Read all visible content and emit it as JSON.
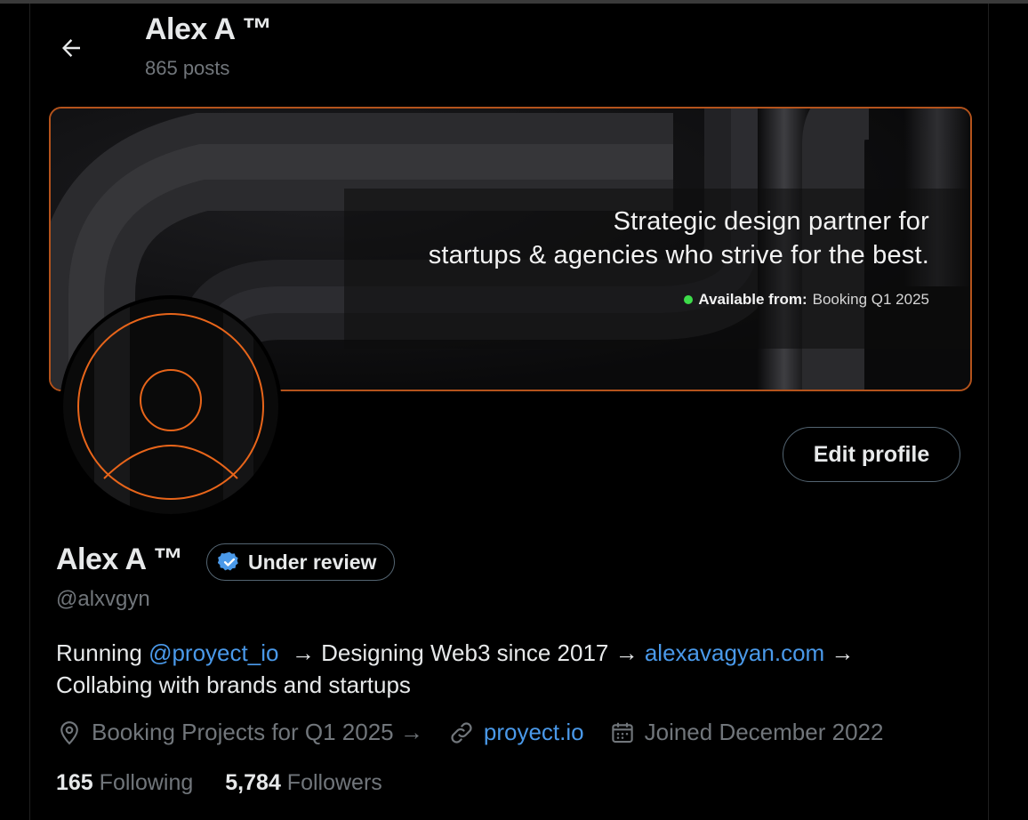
{
  "header": {
    "title": "Alex A ™",
    "post_count": "865 posts"
  },
  "banner": {
    "headline_line1": "Strategic design partner for",
    "headline_line2": "startups & agencies who strive for the best.",
    "availability_label": "Available from:",
    "availability_value": "Booking Q1 2025",
    "border_color": "#b4531c",
    "status_color": "#3ddc4a"
  },
  "profile": {
    "name": "Alex A ™",
    "badge_label": "Under review",
    "handle": "@alxvgyn",
    "edit_button": "Edit profile",
    "avatar_icon": "user-outline-icon"
  },
  "bio": {
    "p1": "Running ",
    "link1": "@proyect_io",
    "p2": "  → Designing Web3 since 2017 → ",
    "link2": "alexavagyan.com",
    "p3": " →",
    "line2": "Collabing with brands and startups"
  },
  "meta": {
    "location": "Booking Projects for Q1 2025 →",
    "website": "proyect.io",
    "joined": "Joined December 2022"
  },
  "stats": {
    "following_count": "165",
    "following_label": "Following",
    "followers_count": "5,784",
    "followers_label": "Followers"
  },
  "colors": {
    "accent_link": "#4a99e9",
    "verified": "#4a99e9",
    "avatar_stroke": "#e8651a"
  }
}
